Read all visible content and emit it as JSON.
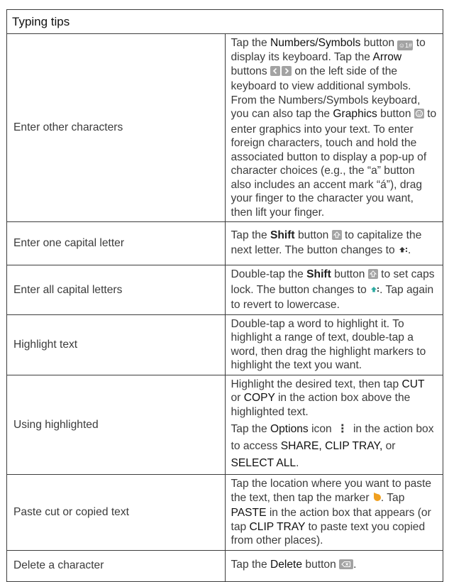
{
  "header": {
    "title": "Typing tips"
  },
  "rows": {
    "enter_other": {
      "label": "Enter other characters",
      "t1": "Tap the ",
      "b1": "Numbers/Symbols",
      "t2": " button ",
      "t3": " to display its keyboard. Tap the ",
      "b2": "Arrow",
      "t4": " buttons ",
      "t5": " on the left side of the keyboard to view additional symbols. From the Numbers/Symbols keyboard, you can also tap the ",
      "b3": "Graphics",
      "t6": " button ",
      "t7": " to enter graphics into your text. To enter foreign characters, touch and hold the associated button to display a pop-up of character choices (e.g., the “a” button also includes an accent mark “á”), drag your finger to the character you want, then lift your finger.",
      "numsym_icon_text": "☺1#"
    },
    "one_capital": {
      "label": "Enter one capital letter",
      "t1": "Tap the ",
      "b1": "Shift",
      "t2": " button ",
      "t3": " to capitalize the next letter. The button changes to ",
      "t4": "."
    },
    "all_capital": {
      "label": "Enter all capital letters",
      "t1": "Double-tap the ",
      "b1": "Shift",
      "t2": " button ",
      "t3": " to set caps lock. The button changes to ",
      "t4": ". Tap again to revert to lowercase."
    },
    "highlight": {
      "label": "Highlight text",
      "text": "Double-tap a word to highlight it. To highlight a range of text, double-tap a word, then drag the highlight markers to highlight the text you want."
    },
    "using_highlighted": {
      "label": "Using highlighted",
      "p1_t1": "Highlight the desired text, then tap ",
      "p1_b1": "CUT",
      "p1_t2": " or ",
      "p1_b2": "COPY",
      "p1_t3": " in the action box above the highlighted text.",
      "p2_t1": "Tap the ",
      "p2_b1": "Options",
      "p2_t2": " icon ",
      "p2_icon": "⋮",
      "p2_t3": " in the action box to access ",
      "p2_b2": "SHARE, CLIP TRAY,",
      "p2_t4": " or ",
      "p2_b3": "SELECT ALL",
      "p2_t5": "."
    },
    "paste": {
      "label": "Paste cut or copied text",
      "t1": "Tap the location where you want to paste the text, then tap the marker ",
      "t2": ". Tap ",
      "b1": "PASTE",
      "t3": " in the action box that appears (or tap ",
      "b2": "CLIP TRAY",
      "t4": " to paste text you copied from other places)."
    },
    "delete": {
      "label": "Delete a character",
      "t1": "Tap the ",
      "b1": "Delete",
      "t2": " button ",
      "t3": "."
    }
  },
  "colors": {
    "icon_gray": "#a3a3a3",
    "marker_orange": "#f0a020",
    "shift_teal": "#2aa9a0",
    "border": "#3d3d3d"
  }
}
